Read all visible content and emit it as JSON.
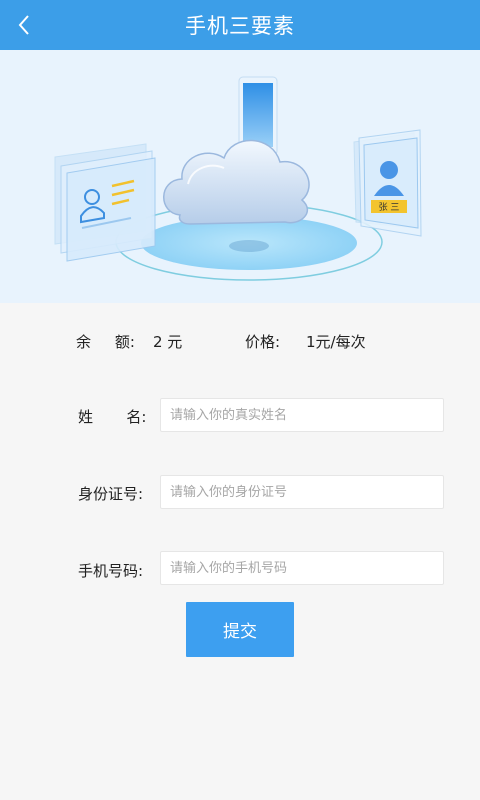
{
  "header": {
    "title": "手机三要素",
    "back_icon": "chevron-left-icon",
    "background": "#3c9ee8"
  },
  "banner": {
    "card_name": "张 三"
  },
  "balance": {
    "label": "余     额:",
    "value": "2 元",
    "price_label": "价格:",
    "price_value": "1元/每次"
  },
  "form": {
    "name": {
      "label": "姓       名:",
      "placeholder": "请输入你的真实姓名",
      "value": ""
    },
    "id_number": {
      "label": "身份证号:",
      "placeholder": "请输入你的身份证号",
      "value": ""
    },
    "phone": {
      "label": "手机号码:",
      "placeholder": "请输入你的手机号码",
      "value": ""
    }
  },
  "submit": {
    "label": "提交",
    "color": "#3d9ff0"
  }
}
